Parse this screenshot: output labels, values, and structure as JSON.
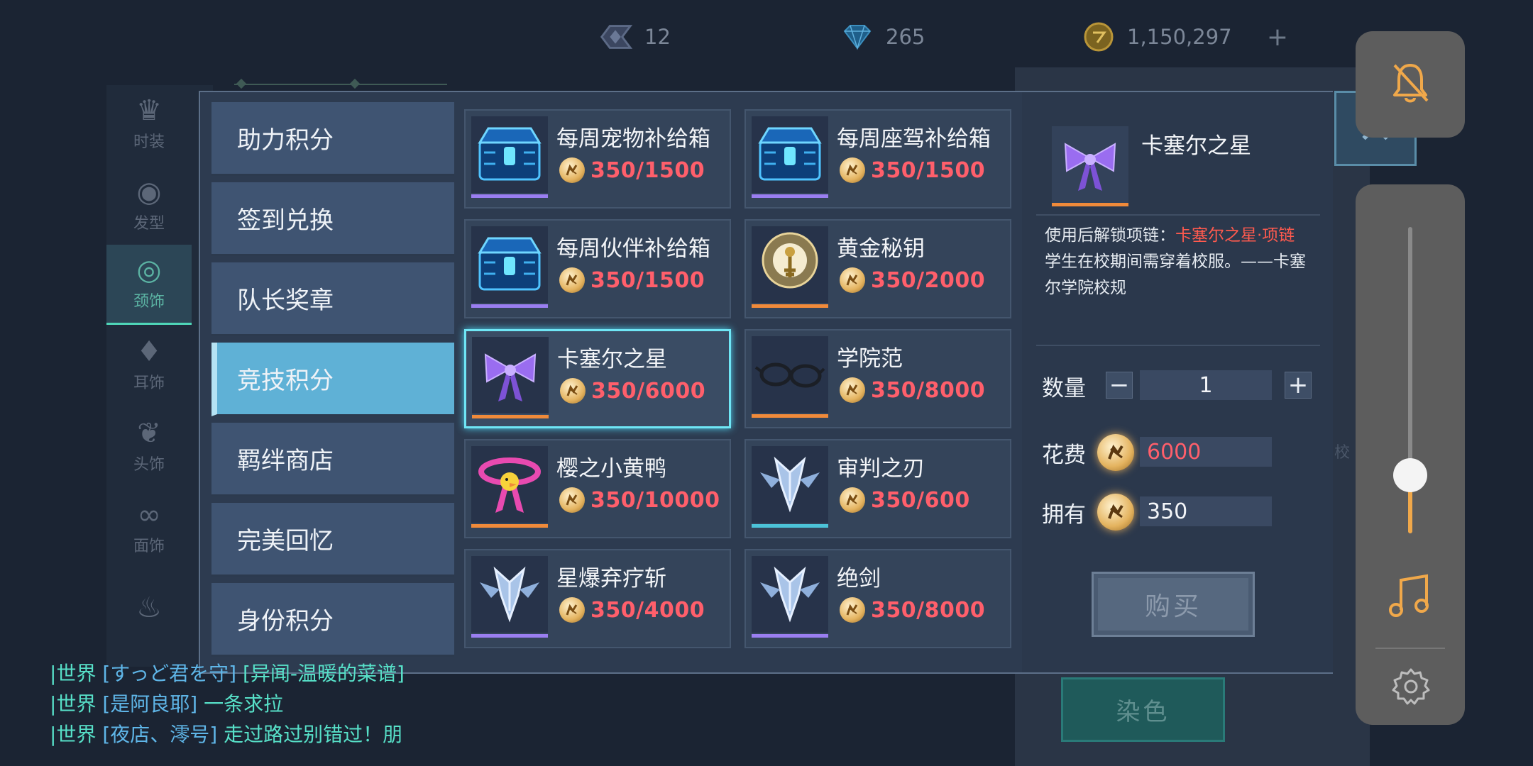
{
  "currency": {
    "crystal": "12",
    "diamond": "265",
    "gold": "1,150,297",
    "add": "+"
  },
  "rail": [
    {
      "label": "时装",
      "glyph": "♛"
    },
    {
      "label": "发型",
      "glyph": "◉"
    },
    {
      "label": "颈饰",
      "glyph": "◎"
    },
    {
      "label": "耳饰",
      "glyph": "♦"
    },
    {
      "label": "头饰",
      "glyph": "❦"
    },
    {
      "label": "面饰",
      "glyph": "∞"
    },
    {
      "label": "",
      "glyph": "♨"
    }
  ],
  "background": {
    "dye_button": "染色",
    "side_text": "校"
  },
  "tabs": [
    {
      "label": "助力积分"
    },
    {
      "label": "签到兑换"
    },
    {
      "label": "队长奖章"
    },
    {
      "label": "竞技积分"
    },
    {
      "label": "羁绊商店"
    },
    {
      "label": "完美回忆"
    },
    {
      "label": "身份积分"
    }
  ],
  "active_tab": 3,
  "items": [
    {
      "name": "每周宠物补给箱",
      "price": "350/1500",
      "icon": "blue-chest-icon",
      "rarity_color": "#9a7ef0"
    },
    {
      "name": "每周座驾补给箱",
      "price": "350/1500",
      "icon": "blue-chest-icon",
      "rarity_color": "#9a7ef0"
    },
    {
      "name": "每周伙伴补给箱",
      "price": "350/1500",
      "icon": "blue-chest-icon",
      "rarity_color": "#9a7ef0"
    },
    {
      "name": "黄金秘钥",
      "price": "350/2000",
      "icon": "golden-key-icon",
      "rarity_color": "#f08a3a"
    },
    {
      "name": "卡塞尔之星",
      "price": "350/6000",
      "icon": "purple-bow-icon",
      "rarity_color": "#f08a3a"
    },
    {
      "name": "学院范",
      "price": "350/8000",
      "icon": "glasses-icon",
      "rarity_color": "#f08a3a"
    },
    {
      "name": "樱之小黄鸭",
      "price": "350/10000",
      "icon": "duck-collar-icon",
      "rarity_color": "#f08a3a"
    },
    {
      "name": "审判之刃",
      "price": "350/600",
      "icon": "blade-emblem-icon",
      "rarity_color": "#4cc3d8"
    },
    {
      "name": "星爆弃疗斩",
      "price": "350/4000",
      "icon": "blade-emblem-icon",
      "rarity_color": "#9a7ef0"
    },
    {
      "name": "绝剑",
      "price": "350/8000",
      "icon": "blade-emblem-icon",
      "rarity_color": "#9a7ef0"
    }
  ],
  "selected_item": 4,
  "detail": {
    "name": "卡塞尔之星",
    "desc_prefix": "使用后解锁项链：",
    "desc_highlight": "卡塞尔之星·项链",
    "desc_body": "学生在校期间需穿着校服。——卡塞尔学院校规",
    "qty_label": "数量",
    "qty_minus": "−",
    "qty_value": "1",
    "qty_plus": "+",
    "cost_label": "花费",
    "cost_value": "6000",
    "own_label": "拥有",
    "own_value": "350",
    "buy_label": "购买"
  },
  "colors": {
    "price_red": "#ff5f6b",
    "own_white": "#f3f5f8",
    "highlight_red": "#ff5a4e",
    "selected_border": "#6fe6f5",
    "active_tab": "#5fb1d6"
  },
  "chat": [
    {
      "channel": "世界",
      "name": "[すっど君を守]",
      "msg": "[异闻-温暖的菜谱]"
    },
    {
      "channel": "世界",
      "name": "[是阿良耶]",
      "msg": "一条求拉"
    },
    {
      "channel": "世界",
      "name": "[夜店、澪号]",
      "msg": "走过路过别错过！朋"
    }
  ],
  "system": {
    "volume_level": 0.19,
    "icons": [
      "bell-muted-icon",
      "music-note-icon",
      "settings-gear-icon"
    ]
  }
}
